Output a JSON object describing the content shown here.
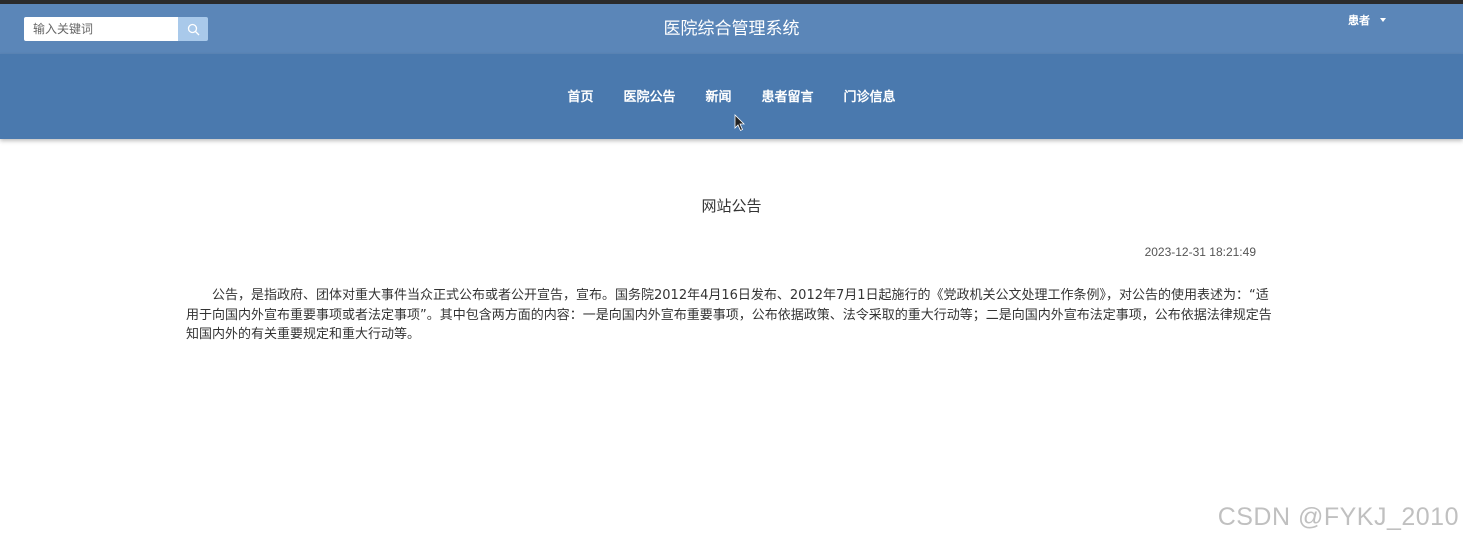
{
  "header": {
    "search_placeholder": "输入关键词",
    "search_icon": "search-icon",
    "site_title": "医院综合管理系统",
    "user_label": "患者"
  },
  "nav": {
    "items": [
      {
        "label": "首页"
      },
      {
        "label": "医院公告"
      },
      {
        "label": "新闻"
      },
      {
        "label": "患者留言"
      },
      {
        "label": "门诊信息"
      }
    ]
  },
  "notice": {
    "title": "网站公告",
    "date": "2023-12-31 18:21:49",
    "body": "公告，是指政府、团体对重大事件当众正式公布或者公开宣告，宣布。国务院2012年4月16日发布、2012年7月1日起施行的《党政机关公文处理工作条例》，对公告的使用表述为：“适用于向国内外宣布重要事项或者法定事项”。其中包含两方面的内容：一是向国内外宣布重要事项，公布依据政策、法令采取的重大行动等；二是向国内外宣布法定事项，公布依据法律规定告知国内外的有关重要规定和重大行动等。"
  },
  "watermark": "CSDN @FYKJ_2010",
  "colors": {
    "topbar": "#5b86b8",
    "navbar": "#4a79ae",
    "search_button": "#a9c9ea"
  }
}
